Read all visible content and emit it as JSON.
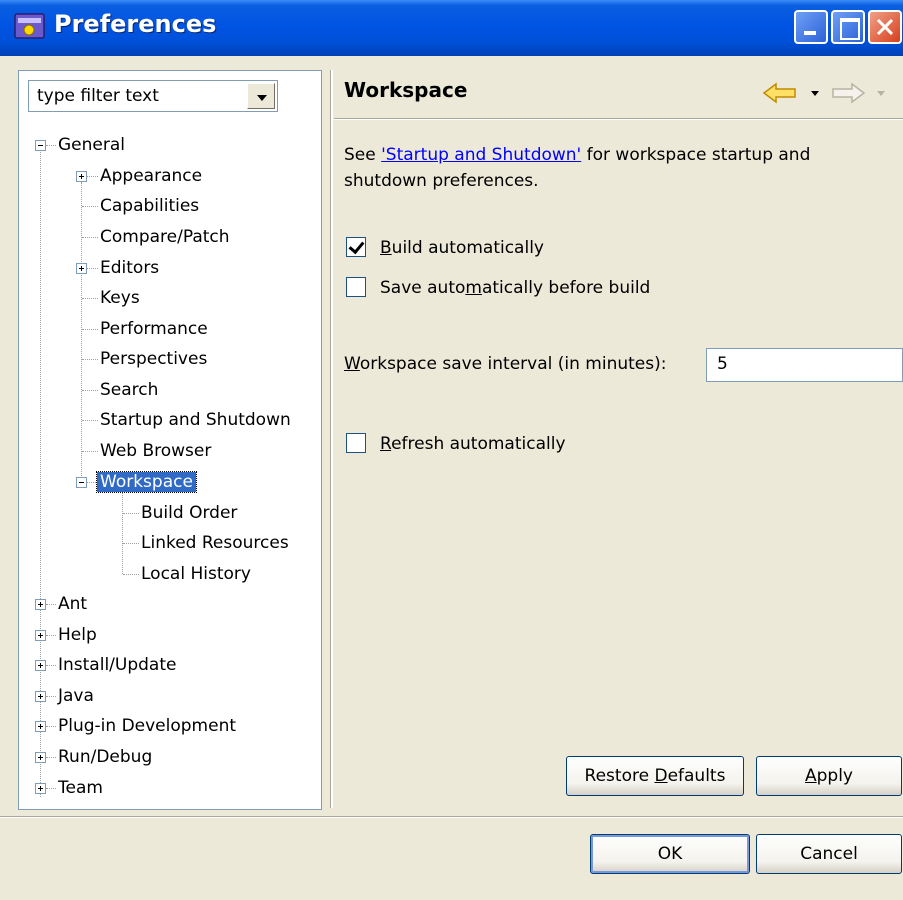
{
  "window": {
    "title": "Preferences"
  },
  "filter": {
    "placeholder": "type filter text"
  },
  "tree": {
    "general": "General",
    "appearance": "Appearance",
    "capabilities": "Capabilities",
    "compare_patch": "Compare/Patch",
    "editors": "Editors",
    "keys": "Keys",
    "performance": "Performance",
    "perspectives": "Perspectives",
    "search": "Search",
    "startup_shutdown": "Startup and Shutdown",
    "web_browser": "Web Browser",
    "workspace": "Workspace",
    "build_order": "Build Order",
    "linked_resources": "Linked Resources",
    "local_history": "Local History",
    "ant": "Ant",
    "help": "Help",
    "install_update": "Install/Update",
    "java": "Java",
    "plugin_dev": "Plug-in Development",
    "run_debug": "Run/Debug",
    "team": "Team"
  },
  "page": {
    "title": "Workspace",
    "info_prefix": "See ",
    "info_link": "'Startup and Shutdown'",
    "info_suffix": " for workspace startup and shutdown preferences.",
    "build_auto": {
      "pre": "",
      "u": "B",
      "post": "uild automatically",
      "checked": true
    },
    "save_auto": {
      "pre": "Save auto",
      "u": "m",
      "post": "atically before build",
      "checked": false
    },
    "interval": {
      "pre": "",
      "u": "W",
      "post": "orkspace save interval (in minutes):",
      "value": "5"
    },
    "refresh_auto": {
      "pre": "",
      "u": "R",
      "post": "efresh automatically",
      "checked": false
    }
  },
  "buttons": {
    "restore": {
      "pre": "Restore ",
      "u": "D",
      "post": "efaults"
    },
    "apply": {
      "pre": "",
      "u": "A",
      "post": "pply"
    },
    "ok": "OK",
    "cancel": "Cancel"
  },
  "colors": {
    "title_bar": "#0054e3",
    "selection": "#316ac5",
    "link": "#0000ff",
    "nav_arrow": "#f5c000"
  },
  "icons": {
    "back": "back-arrow-icon",
    "forward": "forward-arrow-icon",
    "app": "eclipse-window-icon"
  }
}
